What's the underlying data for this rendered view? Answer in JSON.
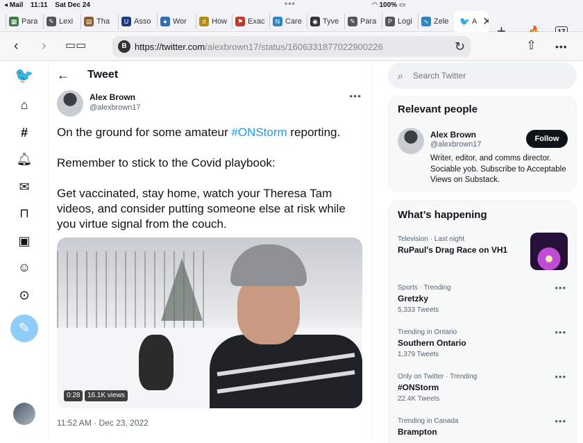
{
  "status_bar": {
    "back_app": "◂ Mail",
    "time": "11:11",
    "date": "Sat Dec 24",
    "battery": "100%"
  },
  "tabs": [
    {
      "label": "Para",
      "icon": "icon-para",
      "color": "#3a7d44"
    },
    {
      "label": "Lexi",
      "icon": "icon-lexi",
      "color": "#555555"
    },
    {
      "label": "Tha",
      "icon": "icon-tha",
      "color": "#8a5a2b"
    },
    {
      "label": "Asso",
      "icon": "icon-asso",
      "color": "#1f3a7a"
    },
    {
      "label": "Wor",
      "icon": "icon-wor",
      "color": "#2f6fb3"
    },
    {
      "label": "How",
      "icon": "icon-how",
      "color": "#b08a1a"
    },
    {
      "label": "Exac",
      "icon": "icon-exac",
      "color": "#c0392b"
    },
    {
      "label": "Care",
      "icon": "icon-care",
      "color": "#2e86c1"
    },
    {
      "label": "Tyve",
      "icon": "icon-tyve",
      "color": "#333333"
    },
    {
      "label": "Para",
      "icon": "icon-para2",
      "color": "#555555"
    },
    {
      "label": "Logi",
      "icon": "icon-logi",
      "color": "#555555"
    },
    {
      "label": "Zele",
      "icon": "icon-zele",
      "color": "#2e86c1"
    },
    {
      "label": "A",
      "icon": "twitter-icon",
      "color": "#1d9bf0"
    }
  ],
  "tab_count": "17",
  "address": {
    "badge": "B",
    "host": "https://twitter.com",
    "path": "/alexbrown17/status/1606331877022900226"
  },
  "main": {
    "header_title": "Tweet",
    "author_name": "Alex Brown",
    "author_handle": "@alexbrown17",
    "text_line1_pre": "On the ground for some amateur ",
    "text_line1_tag": "#ONStorm",
    "text_line1_post": " reporting.",
    "text_para2": "Remember to stick to the Covid playbook:",
    "text_para3": "Get vaccinated, stay home, watch your Theresa Tam videos, and consider putting someone else at risk while you virtue signal from the couch.",
    "video_duration": "0:28",
    "video_views": "16.1K views",
    "timestamp": "11:52 AM · Dec 23, 2022"
  },
  "right": {
    "search_placeholder": "Search Twitter",
    "relevant_title": "Relevant people",
    "rp_name": "Alex Brown",
    "rp_handle": "@alexbrown17",
    "rp_follow": "Follow",
    "rp_bio": "Writer, editor, and comms director. Sociable yob. Subscribe to Acceptable Views on Substack.",
    "happening_title": "What’s happening",
    "trends": [
      {
        "meta": "Television · Last night",
        "name": "RuPaul's Drag Race on VH1",
        "count": ""
      },
      {
        "meta": "Sports · Trending",
        "name": "Gretzky",
        "count": "5,333 Tweets"
      },
      {
        "meta": "Trending in Ontario",
        "name": "Southern Ontario",
        "count": "1,379 Tweets"
      },
      {
        "meta": "Only on Twitter · Trending",
        "name": "#ONStorm",
        "count": "22.4K Tweets"
      },
      {
        "meta": "Trending in Canada",
        "name": "Brampton",
        "count": ""
      }
    ]
  }
}
